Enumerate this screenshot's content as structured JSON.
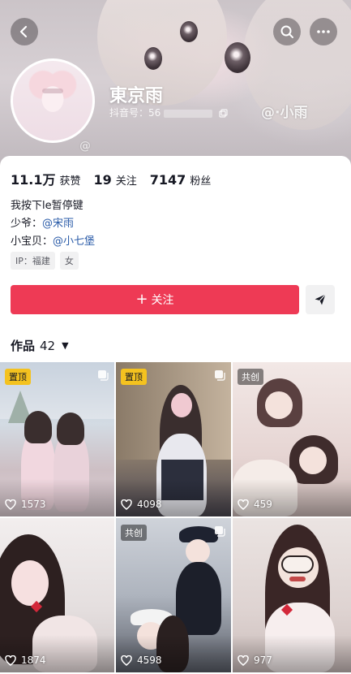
{
  "header": {
    "nickname": "東京雨",
    "account_id": "抖音号：56",
    "watermark_right": "@·小雨",
    "watermark_left": "@"
  },
  "stats": [
    {
      "value": "11.1万",
      "label": "获赞"
    },
    {
      "value": "19",
      "label": "关注"
    },
    {
      "value": "7147",
      "label": "粉丝"
    }
  ],
  "bio": {
    "line1": "我按下le暂停键",
    "line2_prefix": "少爷：",
    "line2_mention": "@宋雨",
    "line3_prefix": "小宝贝：",
    "line3_mention": "@小七堡"
  },
  "tags": [
    "IP：福建",
    "女"
  ],
  "actions": {
    "follow_label": "关注",
    "follow_plus": "+"
  },
  "works": {
    "label": "作品",
    "count": "42",
    "caret": "▼"
  },
  "videos": [
    {
      "badge": "置顶",
      "badge_type": "pinned",
      "likes": "1573",
      "multi": true
    },
    {
      "badge": "置顶",
      "badge_type": "pinned",
      "likes": "4098",
      "multi": true
    },
    {
      "badge": "共创",
      "badge_type": "collab",
      "likes": "459",
      "multi": false
    },
    {
      "badge": "",
      "badge_type": "",
      "likes": "1874",
      "multi": false
    },
    {
      "badge": "共创",
      "badge_type": "collab",
      "likes": "4598",
      "multi": true
    },
    {
      "badge": "",
      "badge_type": "",
      "likes": "977",
      "multi": false
    }
  ],
  "colors": {
    "accent": "#ee3a55",
    "mention": "#2a5ba8",
    "pinned_badge": "#f4c21f"
  },
  "icons": {
    "back": "back-arrow-icon",
    "search": "search-icon",
    "more": "more-icon",
    "copy": "copy-icon",
    "share": "share-icon",
    "heart": "heart-icon",
    "multi": "multi-image-icon"
  }
}
